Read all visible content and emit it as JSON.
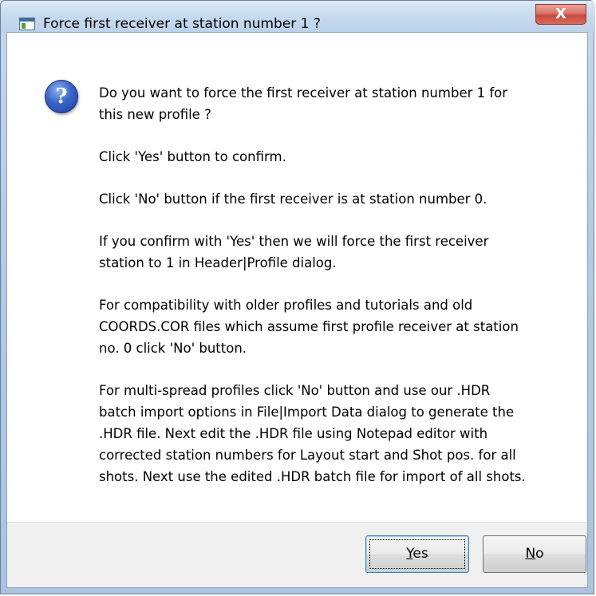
{
  "window": {
    "title": "Force first receiver at station number 1 ?",
    "close_glyph": "X"
  },
  "icon": {
    "name": "question-icon",
    "glyph": "?"
  },
  "message": {
    "p1_line1": "Do you want to force the first receiver at station number 1 for",
    "p1_line2": "this new profile ?",
    "p2": "Click 'Yes' button to confirm.",
    "p3": "Click 'No' button if the first receiver is at station number 0.",
    "p4_line1": "If you confirm with 'Yes' then we will force the first receiver",
    "p4_line2": "station to 1 in Header|Profile dialog.",
    "p5_line1": "For compatibility with older profiles and tutorials and old",
    "p5_line2": "COORDS.COR files which assume first profile receiver at station",
    "p5_line3": "no. 0 click 'No' button.",
    "p6_line1": "For multi-spread profiles click 'No' button and use our .HDR",
    "p6_line2": "batch import options in File|Import Data dialog to generate the",
    "p6_line3": ".HDR file. Next edit the .HDR file using Notepad editor with",
    "p6_line4": "corrected station numbers for Layout start and Shot pos. for all",
    "p6_line5": "shots. Next use the edited .HDR batch file for import of all shots."
  },
  "buttons": {
    "yes_accel": "Y",
    "yes_rest": "es",
    "no_accel": "N",
    "no_rest": "o"
  }
}
